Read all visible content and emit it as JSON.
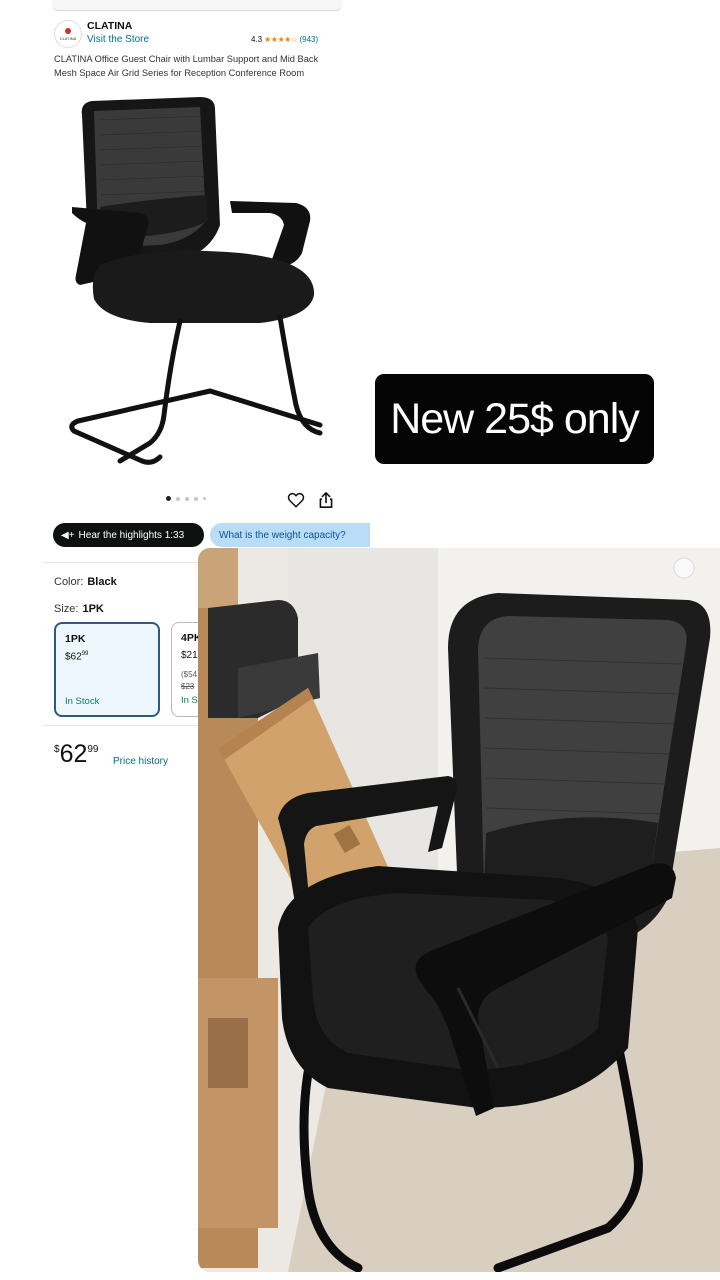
{
  "product": {
    "brand_logo_text": "CLATINA",
    "brand": "CLATINA",
    "store_link": "Visit the Store",
    "rating": "4.3",
    "stars": "★★★★☆",
    "review_count": "(943)",
    "title": "CLATINA Office Guest Chair with Lumbar Support and Mid Back Mesh Space Air Grid Series for Reception Conference Room"
  },
  "carousel": {
    "total_dots": 5,
    "active_index": 0
  },
  "actions": {
    "highlights_label": "Hear the highlights 1:33",
    "question_chip": "What is the weight capacity?"
  },
  "options": {
    "color_label": "Color:",
    "color_value": "Black",
    "size_label": "Size:",
    "size_value": "1PK",
    "cards": [
      {
        "name": "1PK",
        "price_whole": "$62",
        "price_fraction": "99",
        "stock": "In Stock"
      },
      {
        "name": "4PK",
        "price_whole": "$21",
        "unit": "($54",
        "strike": "$23",
        "stock": "In S"
      }
    ]
  },
  "price": {
    "currency": "$",
    "whole": "62",
    "fraction": "99",
    "history_link": "Price history"
  },
  "badge": {
    "text": "New 25$ only"
  },
  "colors": {
    "link": "#007185",
    "stock": "#067d62",
    "selected_border": "#2b5a84",
    "chip_bg": "#b9dcf7",
    "star": "#f08804"
  }
}
